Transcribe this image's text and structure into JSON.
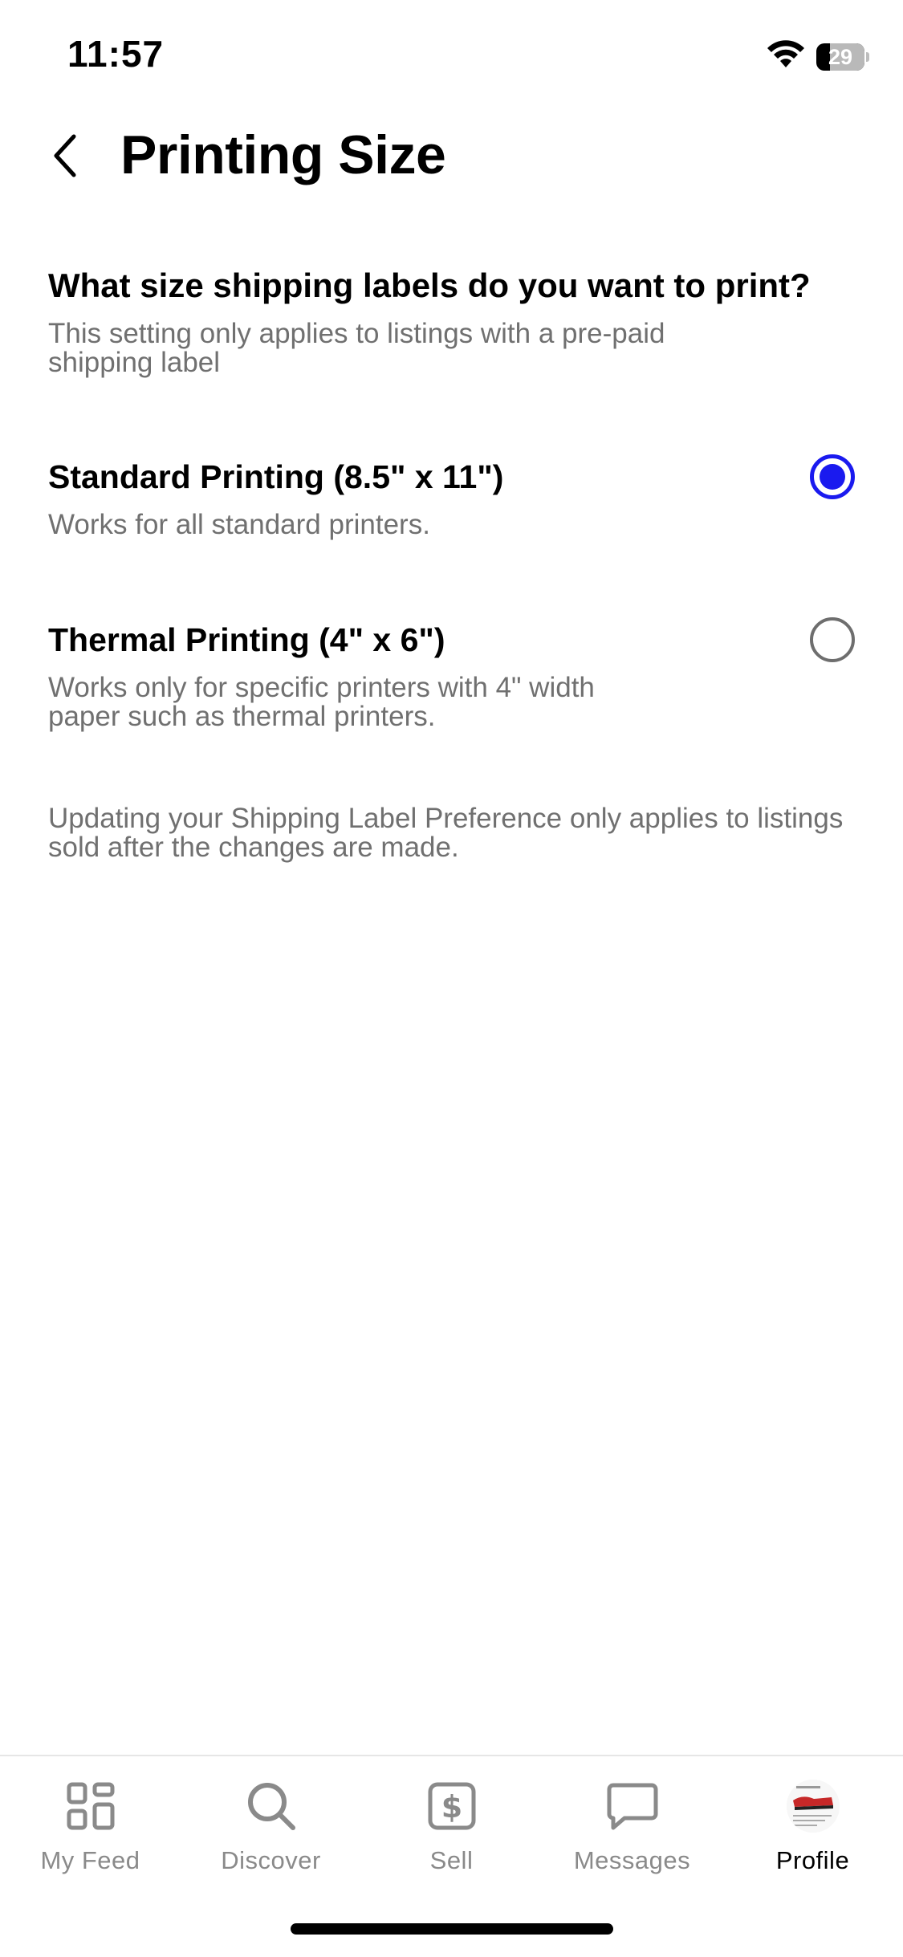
{
  "status_bar": {
    "time": "11:57",
    "battery_level": "29"
  },
  "header": {
    "title": "Printing Size"
  },
  "question": {
    "title": "What size shipping labels do you want to print?",
    "subtitle": "This setting only applies to listings with a pre-paid shipping label"
  },
  "options": [
    {
      "title": "Standard Printing (8.5\" x 11\")",
      "description": "Works for all standard printers.",
      "selected": true
    },
    {
      "title": "Thermal Printing (4\" x 6\")",
      "description": "Works only for specific printers with 4\" width paper such as thermal printers.",
      "selected": false
    }
  ],
  "note": "Updating your Shipping Label Preference only applies to listings sold after the changes are made.",
  "tab_bar": {
    "items": [
      {
        "label": "My Feed",
        "icon": "grid-icon",
        "active": false
      },
      {
        "label": "Discover",
        "icon": "search-icon",
        "active": false
      },
      {
        "label": "Sell",
        "icon": "dollar-tag-icon",
        "active": false
      },
      {
        "label": "Messages",
        "icon": "chat-bubble-icon",
        "active": false
      },
      {
        "label": "Profile",
        "icon": "avatar",
        "active": true
      }
    ]
  },
  "colors": {
    "accent": "#1a1aef",
    "secondary_text": "#707070",
    "inactive_tab": "#8a8a8a"
  }
}
